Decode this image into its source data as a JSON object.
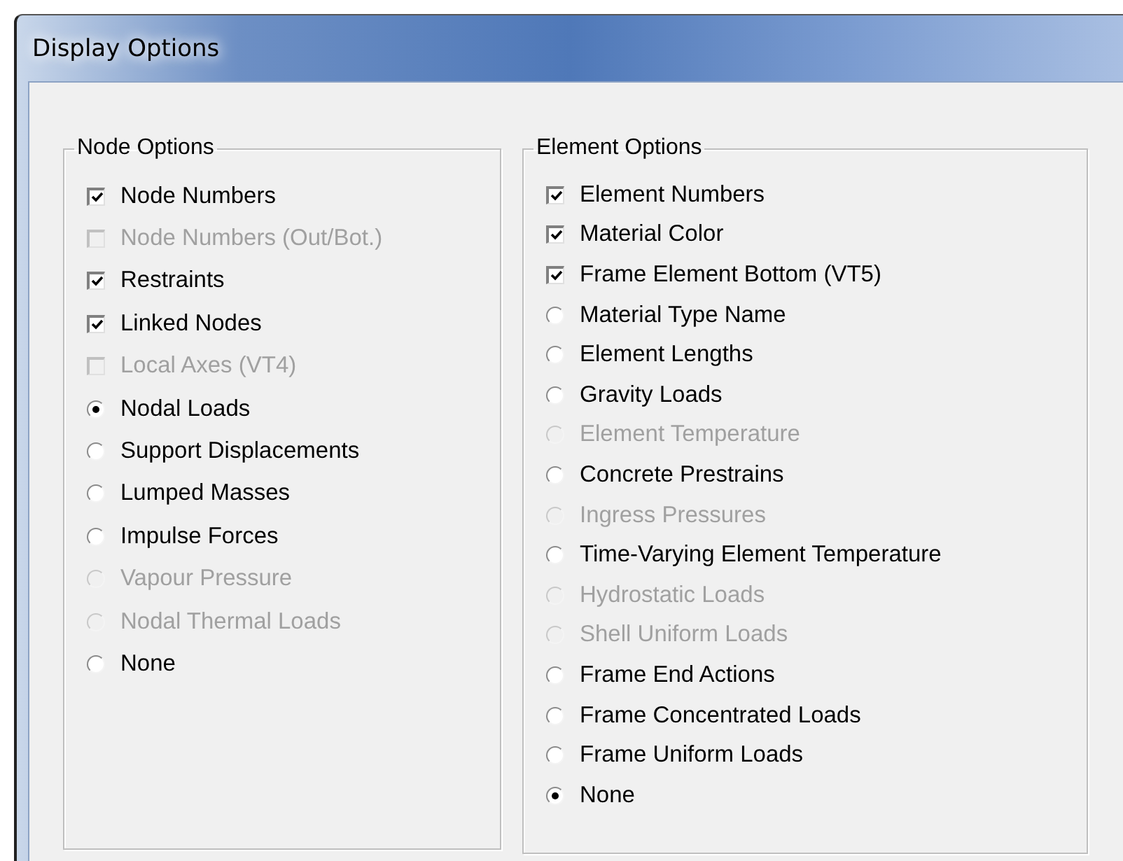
{
  "window": {
    "title": "Display Options"
  },
  "groups": [
    {
      "title": "Node Options",
      "items": [
        {
          "kind": "checkbox",
          "label": "Node Numbers",
          "checked": true,
          "disabled": false
        },
        {
          "kind": "checkbox",
          "label": "Node Numbers (Out/Bot.)",
          "checked": false,
          "disabled": true
        },
        {
          "kind": "checkbox",
          "label": "Restraints",
          "checked": true,
          "disabled": false
        },
        {
          "kind": "checkbox",
          "label": "Linked Nodes",
          "checked": true,
          "disabled": false
        },
        {
          "kind": "checkbox",
          "label": "Local Axes (VT4)",
          "checked": false,
          "disabled": true
        },
        {
          "kind": "radio",
          "label": "Nodal Loads",
          "selected": true,
          "disabled": false
        },
        {
          "kind": "radio",
          "label": "Support Displacements",
          "selected": false,
          "disabled": false
        },
        {
          "kind": "radio",
          "label": "Lumped Masses",
          "selected": false,
          "disabled": false
        },
        {
          "kind": "radio",
          "label": "Impulse Forces",
          "selected": false,
          "disabled": false
        },
        {
          "kind": "radio",
          "label": "Vapour Pressure",
          "selected": false,
          "disabled": true
        },
        {
          "kind": "radio",
          "label": "Nodal Thermal Loads",
          "selected": false,
          "disabled": true
        },
        {
          "kind": "radio",
          "label": "None",
          "selected": false,
          "disabled": false
        }
      ]
    },
    {
      "title": "Element Options",
      "items": [
        {
          "kind": "checkbox",
          "label": "Element Numbers",
          "checked": true,
          "disabled": false
        },
        {
          "kind": "checkbox",
          "label": "Material Color",
          "checked": true,
          "disabled": false
        },
        {
          "kind": "checkbox",
          "label": "Frame Element Bottom (VT5)",
          "checked": true,
          "disabled": false
        },
        {
          "kind": "radio",
          "label": "Material Type Name",
          "selected": false,
          "disabled": false
        },
        {
          "kind": "radio",
          "label": "Element Lengths",
          "selected": false,
          "disabled": false
        },
        {
          "kind": "radio",
          "label": "Gravity Loads",
          "selected": false,
          "disabled": false
        },
        {
          "kind": "radio",
          "label": "Element Temperature",
          "selected": false,
          "disabled": true
        },
        {
          "kind": "radio",
          "label": "Concrete Prestrains",
          "selected": false,
          "disabled": false
        },
        {
          "kind": "radio",
          "label": "Ingress Pressures",
          "selected": false,
          "disabled": true
        },
        {
          "kind": "radio",
          "label": "Time-Varying Element Temperature",
          "selected": false,
          "disabled": false
        },
        {
          "kind": "radio",
          "label": "Hydrostatic Loads",
          "selected": false,
          "disabled": true
        },
        {
          "kind": "radio",
          "label": "Shell Uniform Loads",
          "selected": false,
          "disabled": true
        },
        {
          "kind": "radio",
          "label": "Frame End Actions",
          "selected": false,
          "disabled": false
        },
        {
          "kind": "radio",
          "label": "Frame Concentrated Loads",
          "selected": false,
          "disabled": false
        },
        {
          "kind": "radio",
          "label": "Frame Uniform Loads",
          "selected": false,
          "disabled": false
        },
        {
          "kind": "radio",
          "label": "None",
          "selected": true,
          "disabled": false
        }
      ]
    }
  ]
}
